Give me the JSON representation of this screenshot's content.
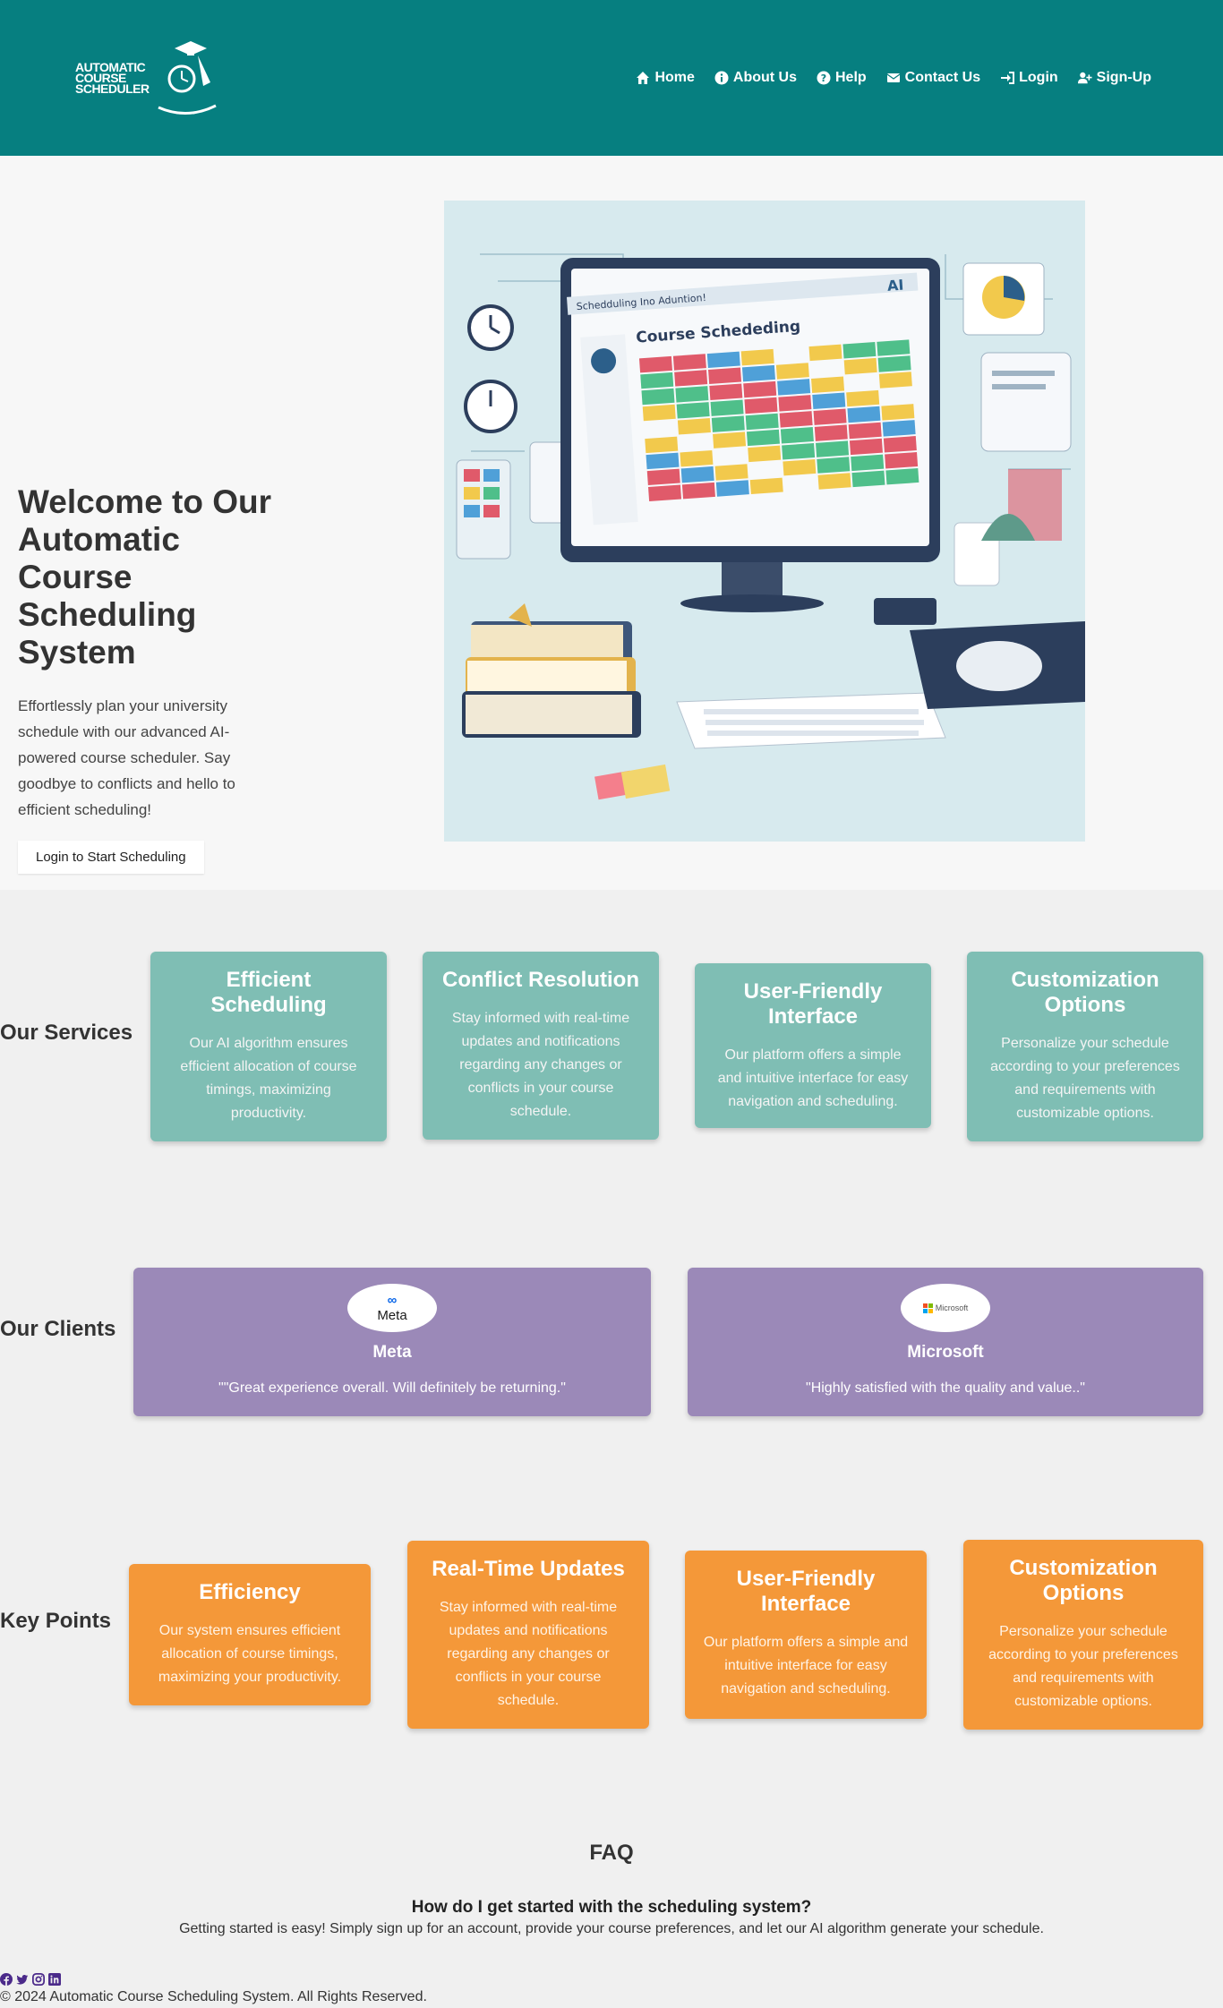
{
  "header": {
    "logo_lines": [
      "AUTOMATIC",
      "COURSE",
      "SCHEDULER"
    ],
    "nav": [
      {
        "label": "Home",
        "icon": "home-icon"
      },
      {
        "label": "About Us",
        "icon": "info-icon"
      },
      {
        "label": "Help",
        "icon": "help-icon"
      },
      {
        "label": "Contact Us",
        "icon": "envelope-icon"
      },
      {
        "label": "Login",
        "icon": "login-icon"
      },
      {
        "label": "Sign-Up",
        "icon": "user-plus-icon"
      }
    ],
    "bg_color": "#067f80"
  },
  "hero": {
    "title": "Welcome to Our Automatic Course Scheduling System",
    "description": "Effortlessly plan your university schedule with our advanced AI-powered course scheduler. Say goodbye to conflicts and hello to efficient scheduling!",
    "button_label": "Login to Start Scheduling",
    "image": {
      "screen_title": "Schedduling Ino Aduntion!",
      "heading": "Course Schededing",
      "badge": "AI"
    }
  },
  "services": {
    "title": "Our Services",
    "cards": [
      {
        "title": "Efficient Scheduling",
        "text": "Our AI algorithm ensures efficient allocation of course timings, maximizing productivity."
      },
      {
        "title": "Conflict Resolution",
        "text": "Stay informed with real-time updates and notifications regarding any changes or conflicts in your course schedule."
      },
      {
        "title": "User-Friendly Interface",
        "text": "Our platform offers a simple and intuitive interface for easy navigation and scheduling."
      },
      {
        "title": "Customization Options",
        "text": "Personalize your schedule according to your preferences and requirements with customizable options."
      }
    ]
  },
  "clients": {
    "title": "Our Clients",
    "items": [
      {
        "name": "Meta",
        "logo_text": "Meta",
        "quote": "\"\"Great experience overall. Will definitely be returning.\""
      },
      {
        "name": "Microsoft",
        "logo_text": "Microsoft",
        "quote": "\"Highly satisfied with the quality and value..\""
      }
    ]
  },
  "key_points": {
    "title": "Key Points",
    "cards": [
      {
        "title": "Efficiency",
        "text": "Our system ensures efficient allocation of course timings, maximizing your productivity."
      },
      {
        "title": "Real-Time Updates",
        "text": "Stay informed with real-time updates and notifications regarding any changes or conflicts in your course schedule."
      },
      {
        "title": "User-Friendly Interface",
        "text": "Our platform offers a simple and intuitive interface for easy navigation and scheduling."
      },
      {
        "title": "Customization Options",
        "text": "Personalize your schedule according to your preferences and requirements with customizable options."
      }
    ]
  },
  "faq": {
    "title": "FAQ",
    "question": "How do I get started with the scheduling system?",
    "answer": "Getting started is easy! Simply sign up for an account, provide your course preferences, and let our AI algorithm generate your schedule."
  },
  "footer": {
    "social": [
      "facebook-icon",
      "twitter-icon",
      "instagram-icon",
      "linkedin-icon"
    ],
    "copyright": "© 2024 Automatic Course Scheduling System. All Rights Reserved."
  },
  "colors": {
    "service_card": "#7fbeb4",
    "client_card": "#9b89b8",
    "key_point_card": "#f49839"
  }
}
